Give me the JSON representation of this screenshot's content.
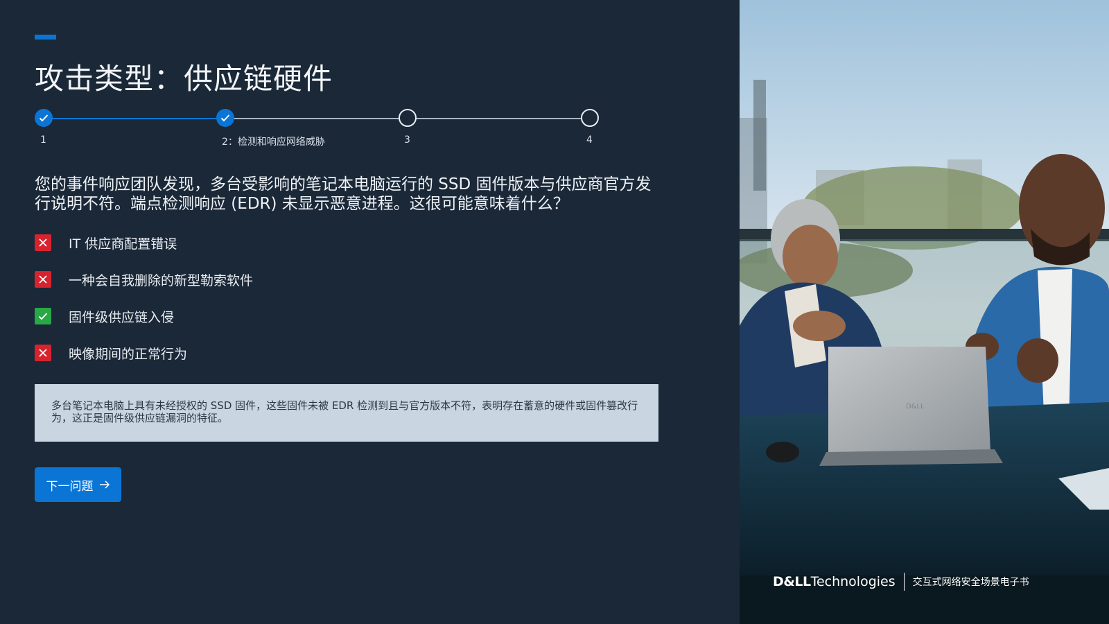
{
  "page": {
    "title": "攻击类型：供应链硬件"
  },
  "stepper": {
    "steps": [
      {
        "label": "1",
        "state": "done"
      },
      {
        "label": "2：检测和响应网络威胁",
        "state": "done"
      },
      {
        "label": "3",
        "state": "todo"
      },
      {
        "label": "4",
        "state": "todo"
      }
    ]
  },
  "question": "您的事件响应团队发现，多台受影响的笔记本电脑运行的 SSD 固件版本与供应商官方发行说明不符。端点检测响应 (EDR) 未显示恶意进程。这很可能意味着什么？",
  "options": [
    {
      "label": "IT 供应商配置错误",
      "result": "wrong"
    },
    {
      "label": "一种会自我删除的新型勒索软件",
      "result": "wrong"
    },
    {
      "label": "固件级供应链入侵",
      "result": "correct"
    },
    {
      "label": "映像期间的正常行为",
      "result": "wrong"
    }
  ],
  "explanation": "多台笔记本电脑上具有未经授权的 SSD 固件，这些固件未被 EDR 检测到且与官方版本不符，表明存在蓄意的硬件或固件篡改行为，这正是固件级供应链漏洞的特征。",
  "next_button": {
    "label": "下一问题",
    "icon": "arrow-right-icon"
  },
  "brand": {
    "logo": "D&LL",
    "logo_suffix": "Technologies",
    "subtitle": "交互式网络安全场景电子书"
  },
  "laptop_logo": "D&LL",
  "colors": {
    "background": "#1b2838",
    "accent": "#0b75d6",
    "wrong": "#d6242f",
    "correct": "#29a845",
    "explanation_bg": "#c9d6e2"
  }
}
